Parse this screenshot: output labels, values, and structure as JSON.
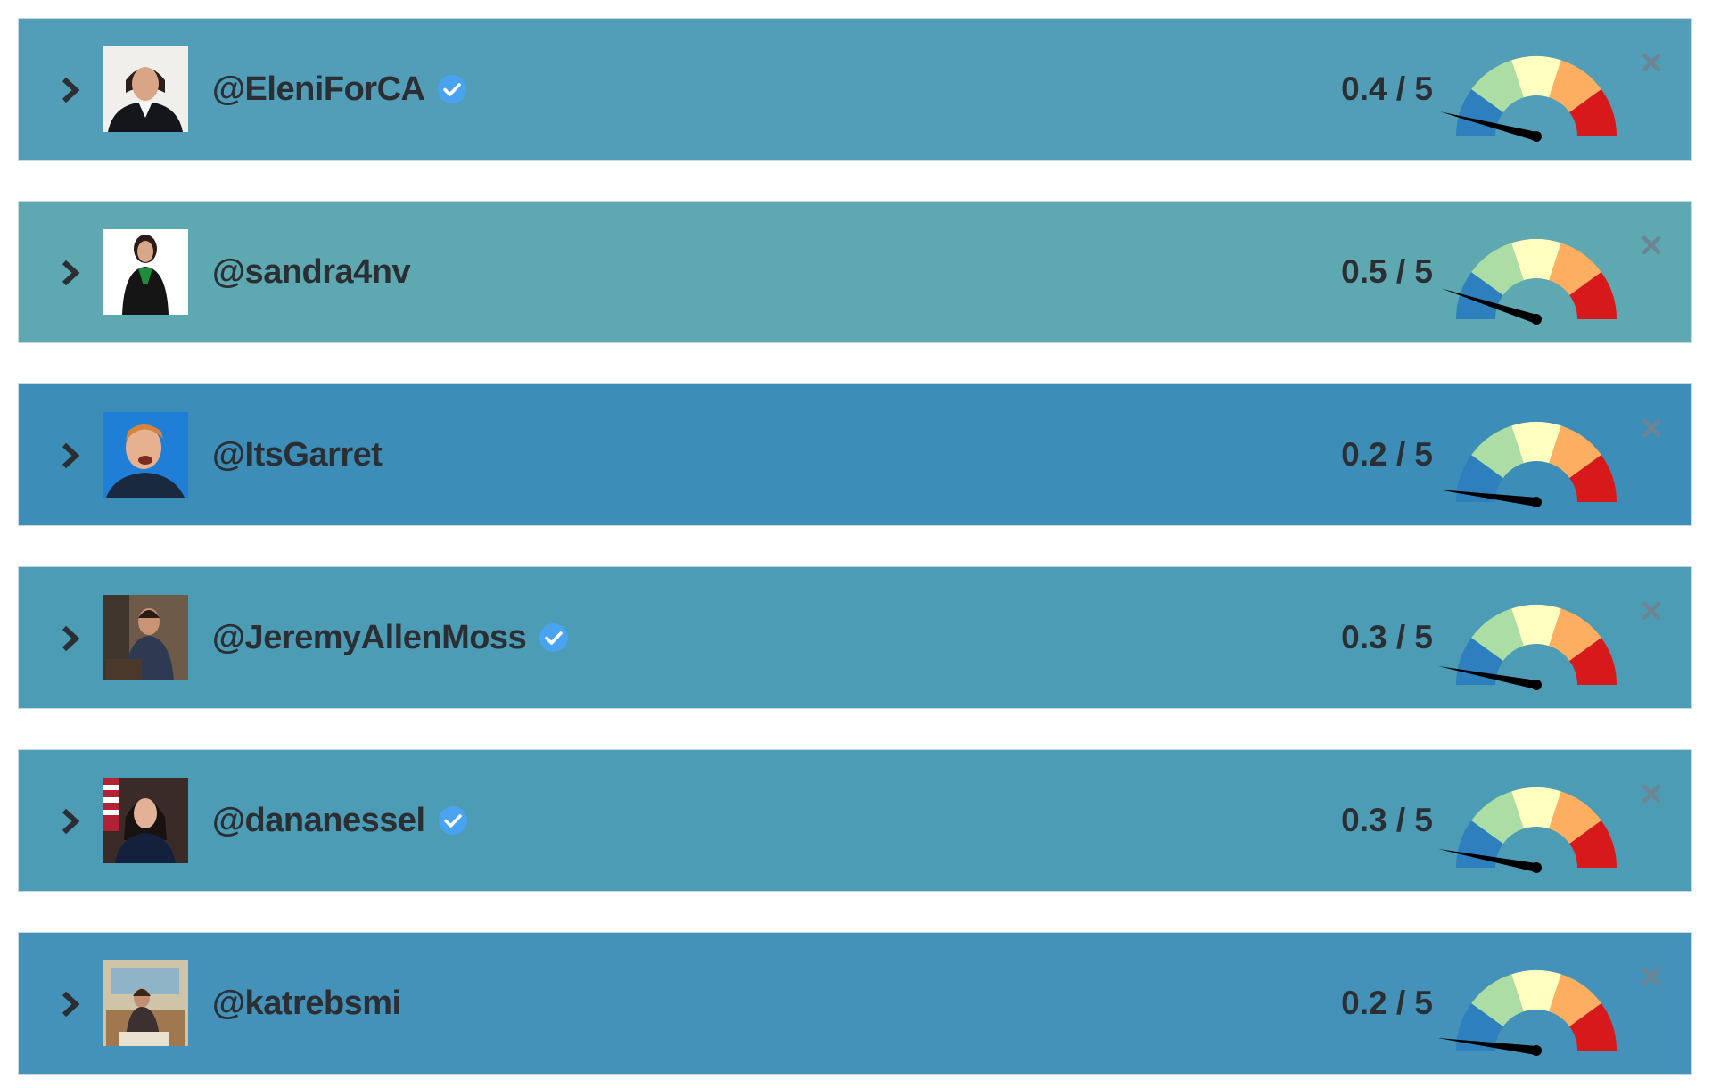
{
  "colors": {
    "gauge_segments": [
      "#2d7fbd",
      "#abdda4",
      "#ffffbf",
      "#fdae61",
      "#d7191c"
    ],
    "needle": "#000000",
    "verified_badge": "#4aa3f0",
    "text": "#2b2f33",
    "close_icon": "#6d8593"
  },
  "accounts": [
    {
      "handle": "@EleniForCA",
      "verified": true,
      "score_text": "0.4 / 5",
      "score": 0.4,
      "row_color": "#529eb8",
      "avatar": "portrait-woman-dark-jacket"
    },
    {
      "handle": "@sandra4nv",
      "verified": false,
      "score_text": "0.5 / 5",
      "score": 0.5,
      "row_color": "#5ea8b1",
      "avatar": "portrait-woman-arms-crossed"
    },
    {
      "handle": "@ItsGarret",
      "verified": false,
      "score_text": "0.2 / 5",
      "score": 0.2,
      "row_color": "#3d8db9",
      "avatar": "portrait-man-blue-background"
    },
    {
      "handle": "@JeremyAllenMoss",
      "verified": true,
      "score_text": "0.3 / 5",
      "score": 0.3,
      "row_color": "#4c9cb6",
      "avatar": "portrait-man-podium"
    },
    {
      "handle": "@dananessel",
      "verified": true,
      "score_text": "0.3 / 5",
      "score": 0.3,
      "row_color": "#4c9cb6",
      "avatar": "portrait-woman-flag-background"
    },
    {
      "handle": "@katrebsmi",
      "verified": false,
      "score_text": "0.2 / 5",
      "score": 0.2,
      "row_color": "#4492b9",
      "avatar": "portrait-woman-seated-room"
    }
  ]
}
